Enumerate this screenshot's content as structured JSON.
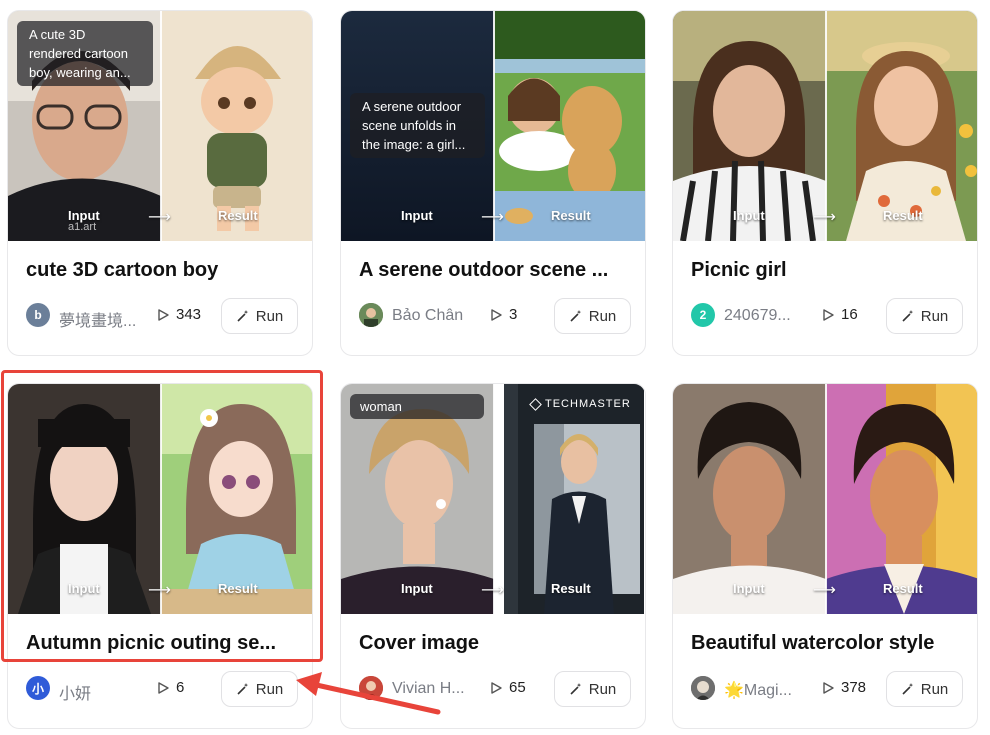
{
  "cards": [
    {
      "title": "cute 3D cartoon boy",
      "author": "夢境畫境...",
      "plays": "343",
      "run_label": "Run",
      "input_label": "Input",
      "result_label": "Result",
      "prompt": "A cute 3D rendered cartoon boy, wearing an...",
      "watermark": "a1.art",
      "avatar_text": "b",
      "avatar_color": "#6b7f99"
    },
    {
      "title": "A serene outdoor scene ...",
      "author": "Bảo Chân",
      "plays": "3",
      "run_label": "Run",
      "input_label": "Input",
      "result_label": "Result",
      "prompt": "A serene outdoor scene unfolds in the image: a girl...",
      "avatar_text": "",
      "avatar_color": "#4a6b3c"
    },
    {
      "title": "Picnic girl",
      "author": "240679...",
      "plays": "16",
      "run_label": "Run",
      "input_label": "Input",
      "result_label": "Result",
      "avatar_text": "2",
      "avatar_color": "#22c7a9"
    },
    {
      "title": "Autumn picnic outing se...",
      "author": "小妍",
      "plays": "6",
      "run_label": "Run",
      "input_label": "Input",
      "result_label": "Result",
      "avatar_text": "小",
      "avatar_color": "#2f5bd8"
    },
    {
      "title": "Cover image",
      "author": "Vivian H...",
      "plays": "65",
      "run_label": "Run",
      "input_label": "Input",
      "result_label": "Result",
      "prompt": "woman",
      "brand": "TECHMASTER",
      "avatar_text": "",
      "avatar_color": "#b23a2c"
    },
    {
      "title": "Beautiful watercolor style",
      "author": "🌟Magi...",
      "plays": "378",
      "run_label": "Run",
      "input_label": "Input",
      "result_label": "Result",
      "avatar_text": "",
      "avatar_color": "#5a5a5a"
    }
  ],
  "colors": {
    "highlight": "#e8443a",
    "text": "#111111",
    "muted": "#7a7d85"
  },
  "icons": {
    "play": "play-outline-icon",
    "run": "magic-wand-icon"
  }
}
